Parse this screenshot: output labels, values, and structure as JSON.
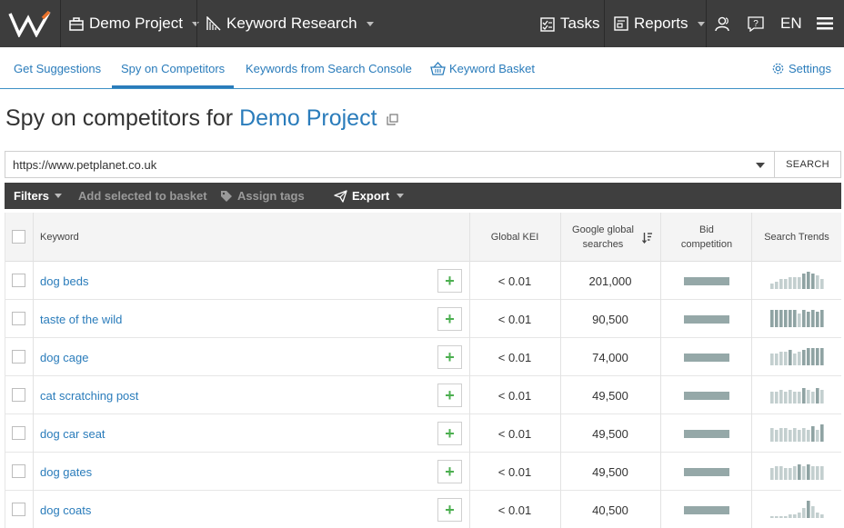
{
  "topbar": {
    "project": "Demo Project",
    "module": "Keyword Research",
    "tasks": "Tasks",
    "reports": "Reports",
    "lang": "EN"
  },
  "subnav": {
    "tabs": [
      "Get Suggestions",
      "Spy on Competitors",
      "Keywords from Search Console",
      "Keyword Basket"
    ],
    "active": "Spy on Competitors",
    "settings": "Settings"
  },
  "page": {
    "title_prefix": "Spy on competitors for",
    "project_name": "Demo Project"
  },
  "search": {
    "value": "https://www.petplanet.co.uk",
    "button": "SEARCH"
  },
  "toolbar": {
    "filters": "Filters",
    "add_basket": "Add selected to basket",
    "assign_tags": "Assign tags",
    "export": "Export"
  },
  "table": {
    "headers": {
      "keyword": "Keyword",
      "kei": "Global KEI",
      "searches_1": "Google global",
      "searches_2": "searches",
      "bid_1": "Bid",
      "bid_2": "competition",
      "trends": "Search Trends"
    },
    "rows": [
      {
        "keyword": "dog beds",
        "kei": "< 0.01",
        "searches": "201,000",
        "trend": [
          3,
          4,
          5,
          5,
          6,
          6,
          6,
          8,
          9,
          8,
          7,
          5
        ]
      },
      {
        "keyword": "taste of the wild",
        "kei": "< 0.01",
        "searches": "90,500",
        "trend": [
          9,
          9,
          9,
          9,
          9,
          9,
          7,
          9,
          8,
          9,
          8,
          9
        ]
      },
      {
        "keyword": "dog cage",
        "kei": "< 0.01",
        "searches": "74,000",
        "trend": [
          6,
          6,
          7,
          7,
          8,
          6,
          7,
          8,
          9,
          9,
          9,
          9
        ]
      },
      {
        "keyword": "cat scratching post",
        "kei": "< 0.01",
        "searches": "49,500",
        "trend": [
          6,
          6,
          7,
          6,
          7,
          6,
          6,
          8,
          7,
          6,
          8,
          7
        ]
      },
      {
        "keyword": "dog car seat",
        "kei": "< 0.01",
        "searches": "49,500",
        "trend": [
          7,
          6,
          7,
          7,
          6,
          7,
          6,
          7,
          6,
          8,
          6,
          9
        ]
      },
      {
        "keyword": "dog gates",
        "kei": "< 0.01",
        "searches": "49,500",
        "trend": [
          6,
          7,
          7,
          6,
          6,
          7,
          8,
          7,
          8,
          7,
          7,
          7
        ]
      },
      {
        "keyword": "dog coats",
        "kei": "< 0.01",
        "searches": "40,500",
        "trend": [
          1,
          1,
          1,
          1,
          2,
          2,
          3,
          5,
          9,
          6,
          3,
          2
        ]
      }
    ]
  },
  "colors": {
    "topbar": "#3d3d3d",
    "link": "#2a7cbb",
    "bid_bar": "#95a8a8",
    "trend_bar": "#c3cfcf",
    "trend_bar_dark": "#8fa3a3",
    "add_plus": "#4caf50"
  }
}
